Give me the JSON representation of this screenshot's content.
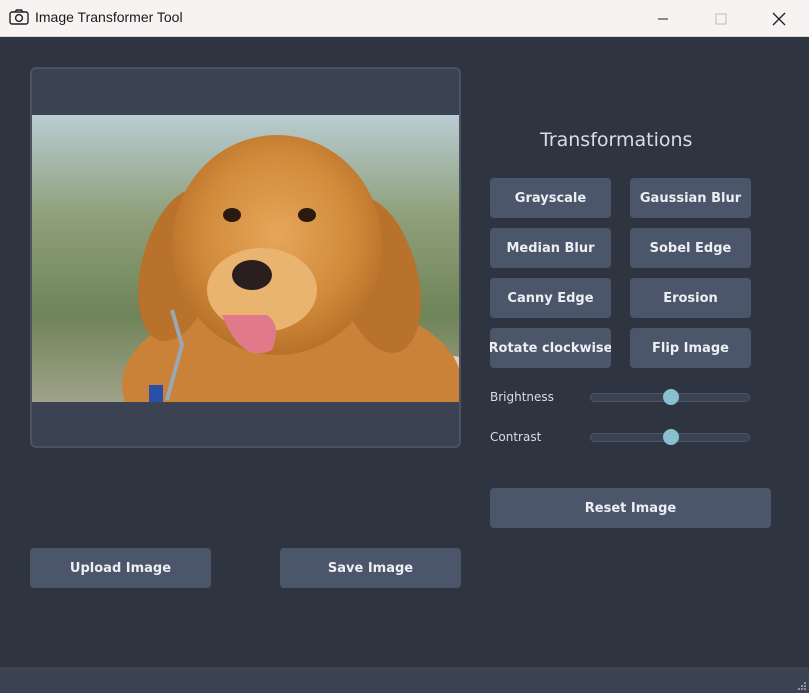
{
  "window": {
    "title": "Image Transformer Tool"
  },
  "panel": {
    "heading": "Transformations"
  },
  "transform_buttons": [
    "Grayscale",
    "Gaussian Blur",
    "Median Blur",
    "Sobel Edge",
    "Canny Edge",
    "Erosion",
    "Rotate clockwise",
    "Flip Image"
  ],
  "sliders": {
    "brightness": {
      "label": "Brightness",
      "value": 0.5
    },
    "contrast": {
      "label": "Contrast",
      "value": 0.5
    }
  },
  "actions": {
    "reset": "Reset Image",
    "upload": "Upload Image",
    "save": "Save Image"
  },
  "colors": {
    "background": "#2e3440",
    "panel": "#3b4252",
    "button": "#4c566a",
    "accent": "#88c0d0"
  },
  "icons": {
    "title": "camera-icon"
  }
}
